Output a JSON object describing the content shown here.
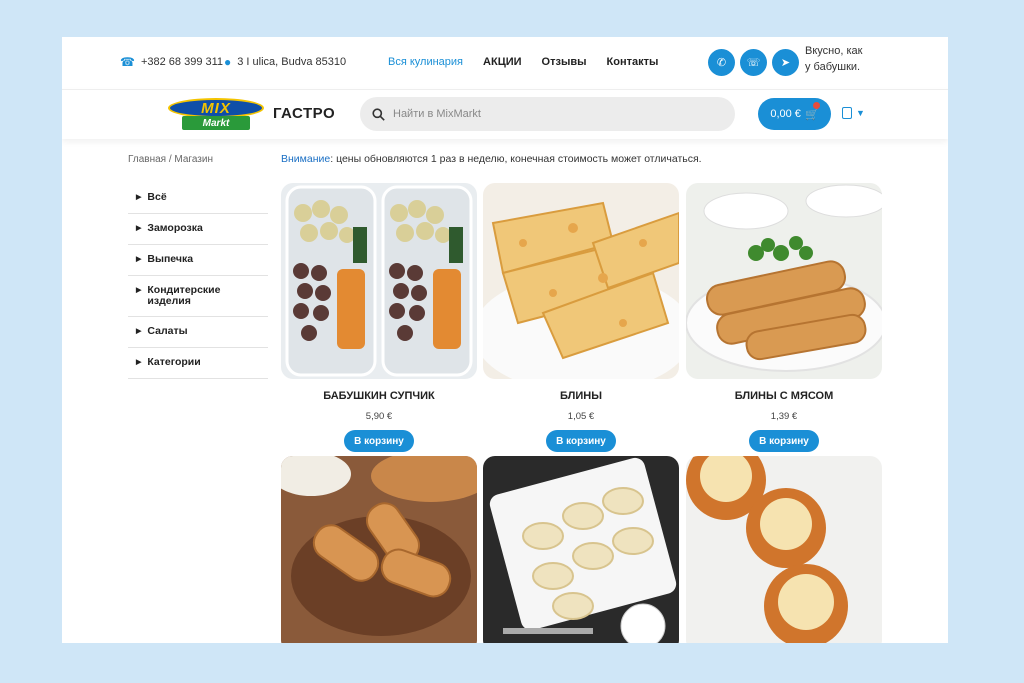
{
  "topbar": {
    "phone": "+382 68 399 311",
    "address": "3 I ulica, Budva 85310",
    "nav": [
      "Вся кулинария",
      "АКЦИИ",
      "Отзывы",
      "Контакты"
    ],
    "slogan_line1": "Вкусно, как",
    "slogan_line2": "у бабушки."
  },
  "header": {
    "logo_top": "MIX",
    "logo_bottom": "Markt",
    "brand": "ГАСТРО",
    "search_placeholder": "Найти в MixMarkt",
    "cart_total": "0,00 €"
  },
  "breadcrumb": "Главная / Магазин",
  "notice": {
    "label": "Внимание",
    "text": ": цены обновляются 1 раз в неделю, конечная стоимость может отличаться."
  },
  "sidebar": [
    "Всё",
    "Заморозка",
    "Выпечка",
    "Кондитерские изделия",
    "Салаты",
    "Категории"
  ],
  "products": [
    {
      "name": "БАБУШКИН СУПЧИК",
      "price": "5,90 €",
      "button": "В корзину"
    },
    {
      "name": "БЛИНЫ",
      "price": "1,05 €",
      "button": "В корзину"
    },
    {
      "name": "БЛИНЫ С МЯСОМ",
      "price": "1,39 €",
      "button": "В корзину"
    }
  ],
  "colors": {
    "accent": "#1a8fd6",
    "background": "#cfe6f7"
  }
}
